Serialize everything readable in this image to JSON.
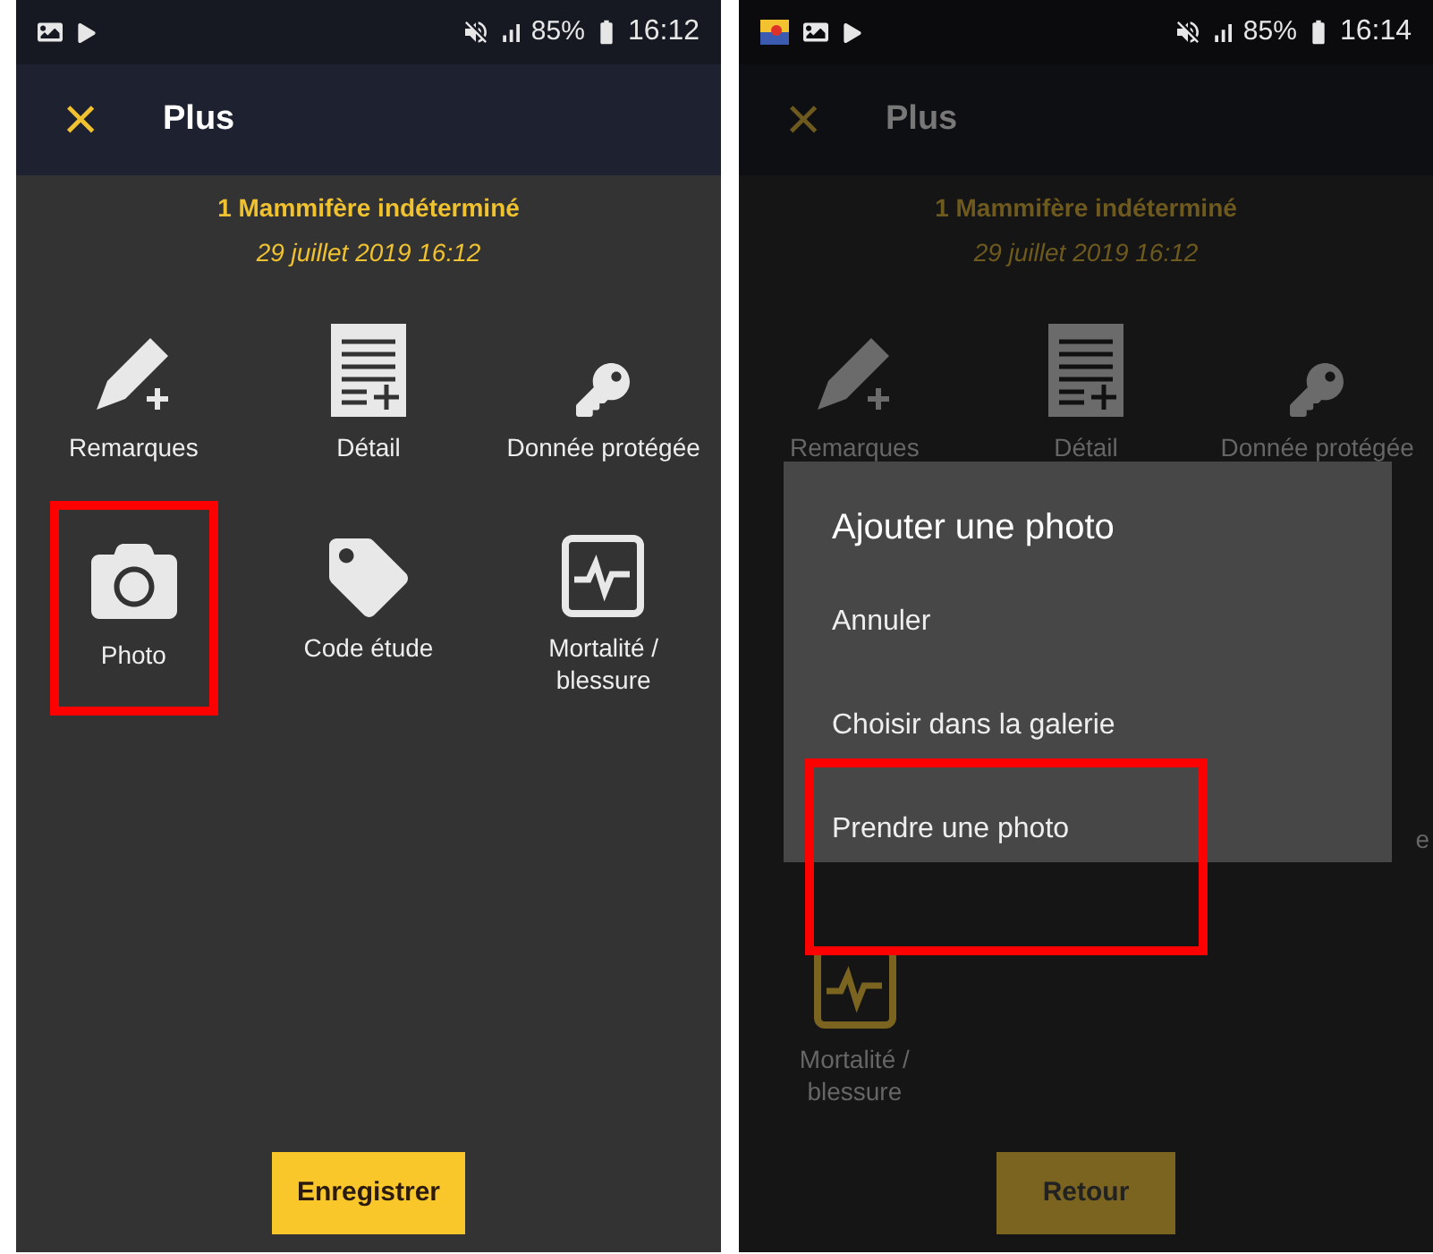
{
  "screens": [
    {
      "dimmed": false,
      "status_bar": {
        "app_notification": false,
        "battery": "85%",
        "time": "16:12"
      },
      "header": {
        "close_icon": "×",
        "title": "Plus"
      },
      "observation": {
        "count": "1",
        "species": "Mammifère indéterminé",
        "date": "29 juillet 2019 16:12"
      },
      "rows": [
        [
          {
            "kind": "pencil",
            "label": "Remarques",
            "highlighted": false
          },
          {
            "kind": "document",
            "label": "Détail",
            "highlighted": false
          },
          {
            "kind": "key",
            "label": "Donnée protégée",
            "highlighted": false
          }
        ],
        [
          {
            "kind": "camera",
            "label": "Photo",
            "highlighted": true
          },
          {
            "kind": "tag",
            "label": "Code étude",
            "highlighted": false
          },
          {
            "kind": "pulse",
            "label": "Mortalité / blessure",
            "highlighted": false
          }
        ]
      ],
      "button": "Enregistrer"
    },
    {
      "dimmed": true,
      "status_bar": {
        "app_notification": true,
        "battery": "85%",
        "time": "16:14"
      },
      "header": {
        "close_icon": "×",
        "title": "Plus"
      },
      "observation": {
        "count": "1",
        "species": "Mammifère indéterminé",
        "date": "29 juillet 2019 16:12"
      },
      "rows": [
        [
          {
            "kind": "pencil",
            "label": "Remarques",
            "highlighted": false
          },
          {
            "kind": "document",
            "label": "Détail",
            "highlighted": false
          },
          {
            "kind": "key",
            "label": "Donnée protégée",
            "highlighted": false
          }
        ],
        [
          {
            "kind": "fragment",
            "label": "e"
          }
        ],
        [
          {
            "kind": "pulse",
            "label": "Mortalité / blessure",
            "highlighted": false
          }
        ]
      ],
      "button": "Retour",
      "dialog": {
        "title": "Ajouter une photo",
        "options": [
          {
            "label": "Annuler",
            "highlighted": false
          },
          {
            "label": "Choisir dans la galerie",
            "highlighted": false
          },
          {
            "label": "Prendre une photo",
            "highlighted": true
          }
        ]
      }
    }
  ]
}
